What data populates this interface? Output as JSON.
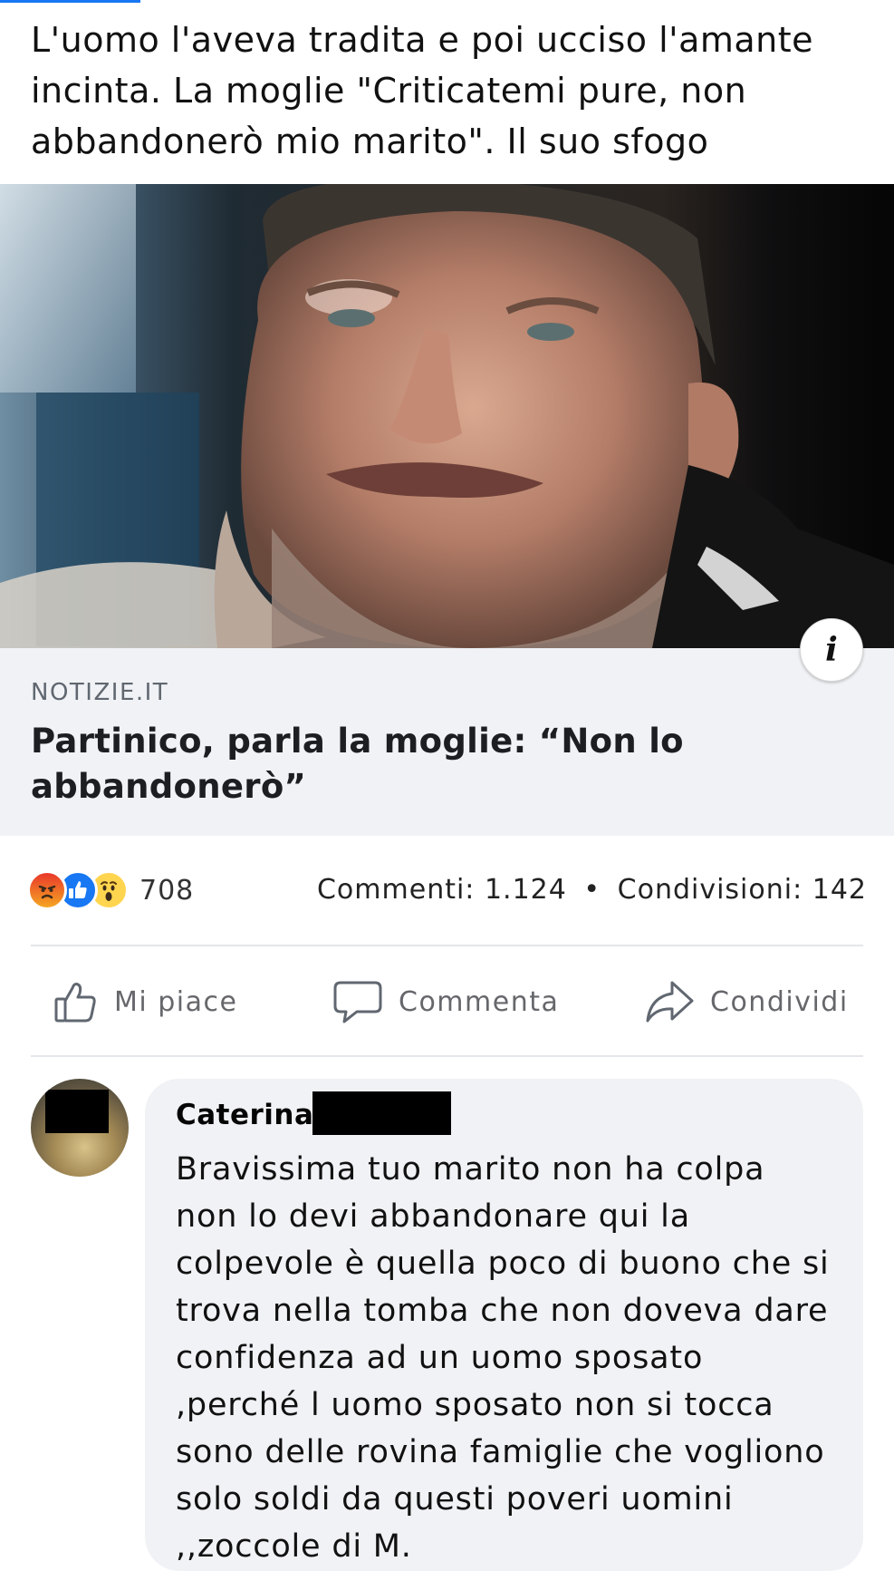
{
  "post": {
    "text": "L'uomo l'aveva tradita e poi ucciso l'amante incinta. La moglie \"Criticatemi pure, non abbandonerò mio marito\". Il suo sfogo"
  },
  "link": {
    "source": "NOTIZIE.IT",
    "title": "Partinico, parla la moglie: “Non lo abbandonerò”",
    "info_icon": "i"
  },
  "stats": {
    "reaction_count": "708",
    "comments": "Commenti: 1.124",
    "separator": "•",
    "shares": "Condivisioni: 142",
    "reaction_icons": [
      "angry-icon",
      "like-icon",
      "wow-icon"
    ]
  },
  "actions": {
    "like": "Mi piace",
    "comment": "Commenta",
    "share": "Condividi"
  },
  "comment": {
    "author": "Caterina",
    "text": "Bravissima tuo marito non ha colpa non lo devi abbandonare qui la colpevole è quella poco di buono che si trova nella tomba che non doveva dare confidenza ad un uomo sposato ,perché l uomo sposato non si tocca sono delle rovina famiglie che vogliono solo soldi da questi poveri uomini ,,zoccole di M."
  },
  "colors": {
    "brand": "#1877f2",
    "card_bg": "#f0f2f5",
    "muted_text": "#65676b"
  }
}
